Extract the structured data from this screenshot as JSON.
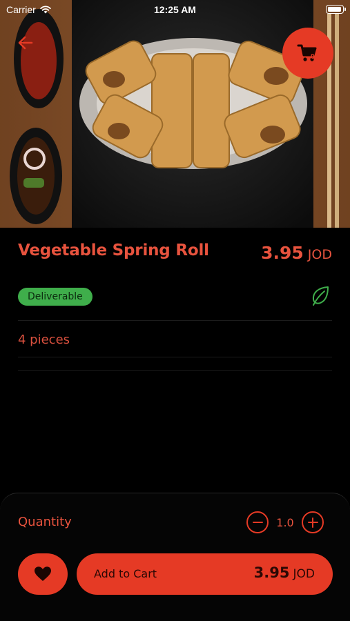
{
  "status_bar": {
    "carrier": "Carrier",
    "time": "12:25 AM"
  },
  "header": {
    "cart_count": "0"
  },
  "product": {
    "name": "Vegetable Spring Roll",
    "price": "3.95",
    "currency": "JOD",
    "badge": "Deliverable",
    "description": "4 pieces"
  },
  "quantity": {
    "label": "Quantity",
    "value": "1.0"
  },
  "actions": {
    "add_to_cart_label": "Add to Cart",
    "total_price": "3.95",
    "currency": "JOD"
  },
  "colors": {
    "accent": "#e53a25",
    "text_accent": "#e8533e",
    "badge": "#3fae4b"
  }
}
